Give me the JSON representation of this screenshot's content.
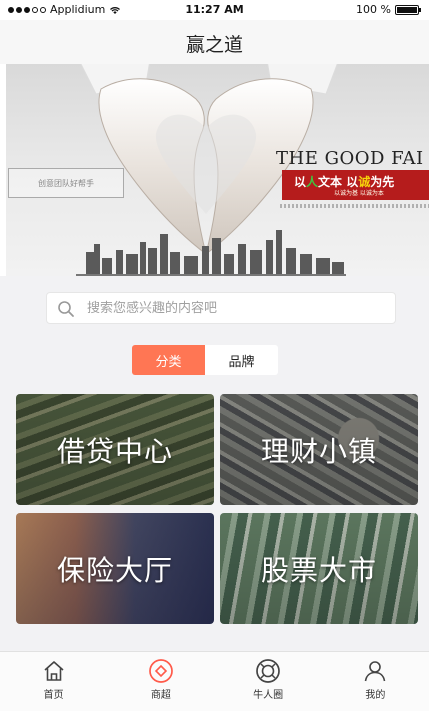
{
  "status_bar": {
    "carrier": "Applidium",
    "time": "11:27 AM",
    "battery": "100 %"
  },
  "nav": {
    "title": "赢之道"
  },
  "banner": {
    "left_plate_text": "创意团队好帮手",
    "slogan_en": "THE GOOD FAI",
    "slogan_cn_parts": [
      "以",
      "人",
      "文本  以",
      "诚",
      "为先"
    ],
    "slogan_cn_sub": "以诚为基  以诚为本"
  },
  "search": {
    "placeholder": "搜索您感兴趣的内容吧"
  },
  "segment": {
    "tabs": [
      {
        "label": "分类",
        "active": true
      },
      {
        "label": "品牌",
        "active": false
      }
    ]
  },
  "tiles": [
    {
      "label": "借贷中心"
    },
    {
      "label": "理财小镇"
    },
    {
      "label": "保险大厅"
    },
    {
      "label": "股票大市"
    }
  ],
  "tab_bar": {
    "items": [
      {
        "label": "首页",
        "icon": "home-icon"
      },
      {
        "label": "商超",
        "icon": "mall-icon",
        "accent": "#ff5a4a"
      },
      {
        "label": "牛人圈",
        "icon": "circle-icon"
      },
      {
        "label": "我的",
        "icon": "profile-icon"
      }
    ]
  },
  "colors": {
    "accent": "#ff7654",
    "banner_red": "#b51c1c"
  }
}
